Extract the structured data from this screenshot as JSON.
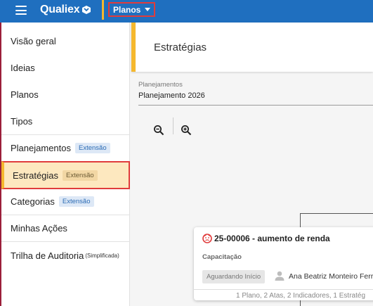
{
  "topbar": {
    "brand": "Qualiex",
    "module_label": "Planos",
    "icons": [
      "hamburger-menu-icon",
      "brand-mark-icon",
      "caret-down-icon"
    ]
  },
  "sidebar": {
    "items": [
      {
        "label": "Visão geral"
      },
      {
        "label": "Ideias"
      },
      {
        "label": "Planos"
      },
      {
        "label": "Tipos"
      },
      {
        "label": "Planejamentos",
        "badge": "Extensão"
      },
      {
        "label": "Estratégias",
        "badge": "Extensão",
        "active": true
      },
      {
        "label": "Categorias",
        "badge": "Extensão"
      },
      {
        "label": "Minhas Ações"
      },
      {
        "label": "Trilha de Auditoria",
        "note": "(Simplificada)"
      }
    ]
  },
  "main": {
    "title": "Estratégias",
    "filter": {
      "label": "Planejamentos",
      "value": "Planejamento 2026"
    },
    "zoom_icons": [
      "zoom-out-icon",
      "zoom-in-icon"
    ]
  },
  "card": {
    "title": "25-00006 - aumento de renda",
    "subtitle": "Capacitação",
    "status": "Aguardando Início",
    "owner": "Ana Beatriz Monteiro Ferr",
    "footer": "1 Plano, 2 Atas, 2 Indicadores, 1 Estratég"
  },
  "colors": {
    "topbar": "#1f6fbf",
    "accent": "#f5b82e",
    "highlight": "#e03c3c",
    "active_bg": "#fde8bf",
    "badge_bg": "#dde8f6",
    "badge_text": "#2c6cb5"
  }
}
